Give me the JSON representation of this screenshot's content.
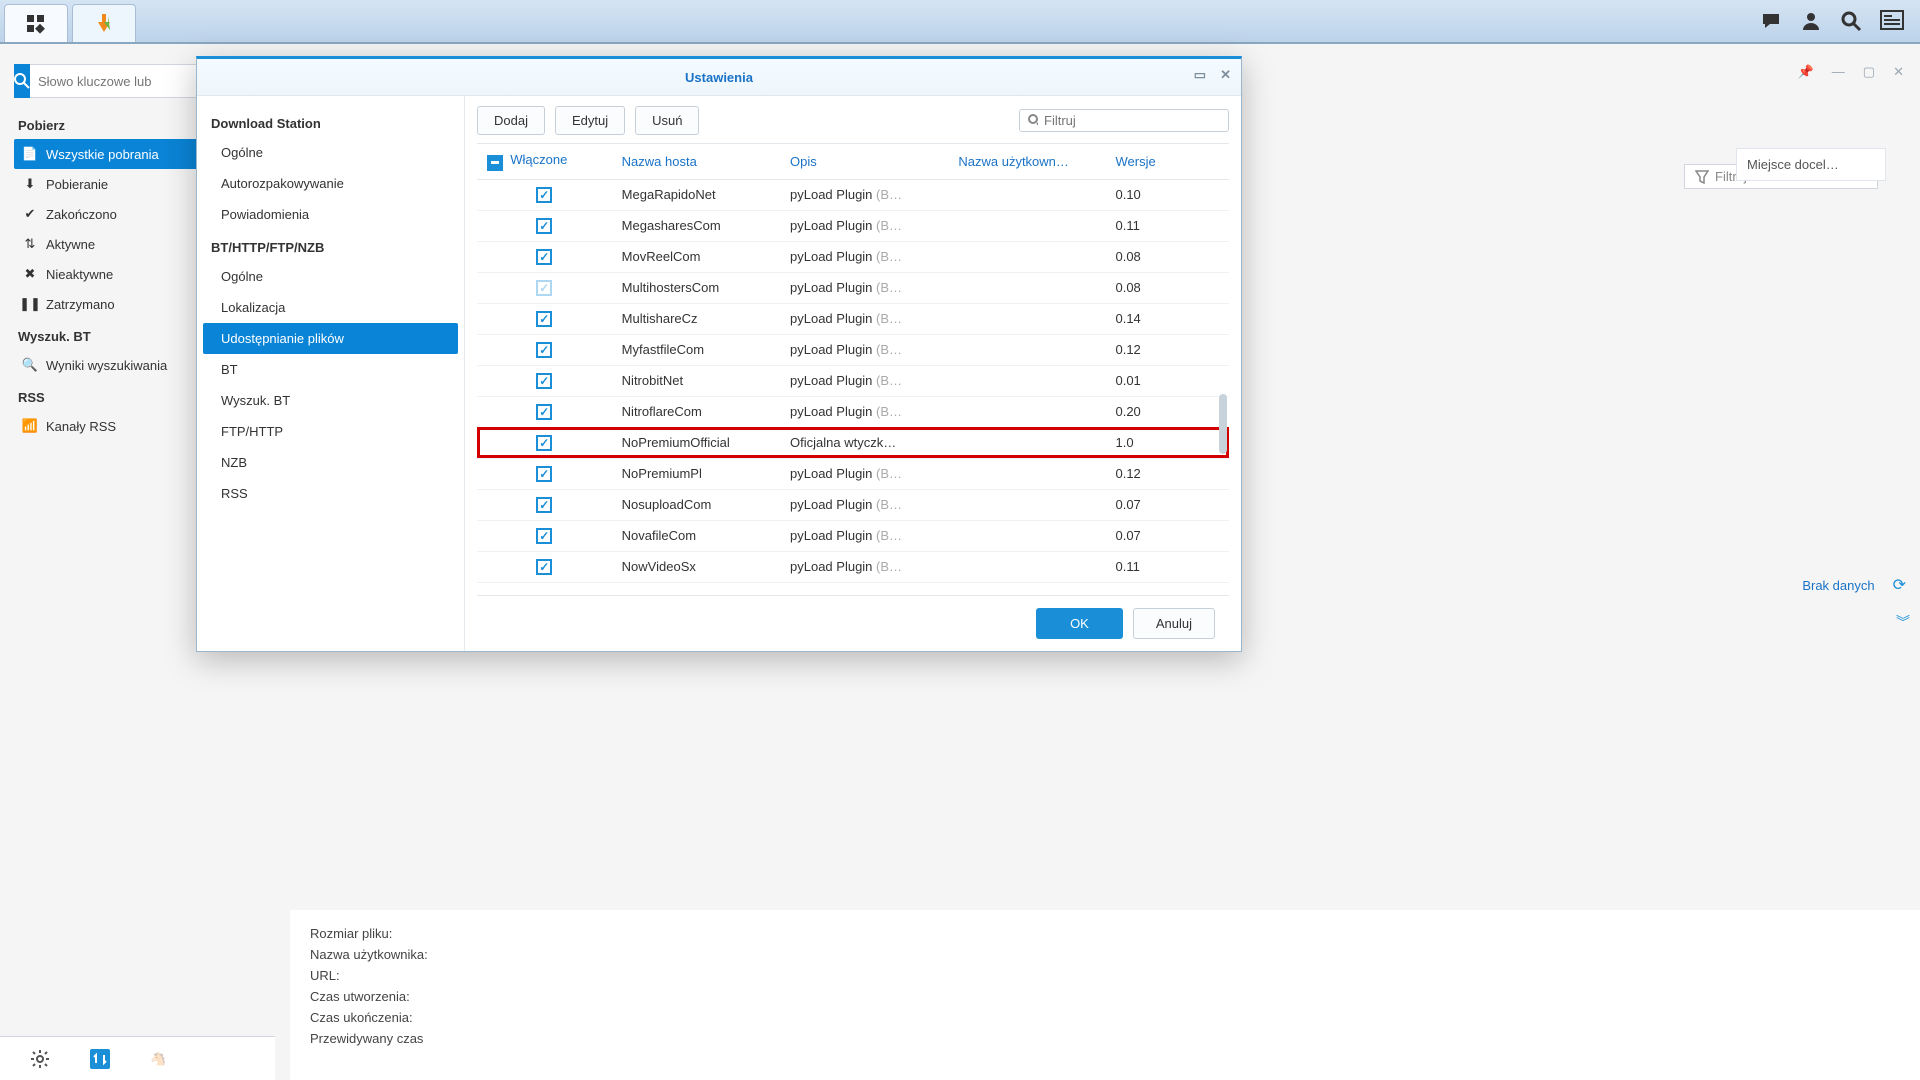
{
  "topbar": {
    "tooltip_chat": "chat",
    "tooltip_user": "user",
    "tooltip_search": "search",
    "tooltip_panel": "panel"
  },
  "app": {
    "search_placeholder": "Słowo kluczowe lub",
    "filter_placeholder": "Filtruj",
    "nav": {
      "downloads_hdr": "Pobierz",
      "all": "Wszystkie pobrania",
      "downloading": "Pobieranie",
      "finished": "Zakończono",
      "active": "Aktywne",
      "inactive": "Nieaktywne",
      "stopped": "Zatrzymano",
      "bt_hdr": "Wyszuk. BT",
      "bt_results": "Wyniki wyszukiwania",
      "rss_hdr": "RSS",
      "rss_channels": "Kanały RSS"
    },
    "dest_col": "Miejsce docel…",
    "no_data": "Brak danych",
    "details": {
      "size": "Rozmiar pliku:",
      "user": "Nazwa użytkownika:",
      "url": "URL:",
      "created": "Czas utworzenia:",
      "finished": "Czas ukończenia:",
      "eta": "Przewidywany czas"
    }
  },
  "modal": {
    "title": "Ustawienia",
    "side": {
      "grp_ds": "Download Station",
      "general": "Ogólne",
      "autoextract": "Autorozpakowywanie",
      "notify": "Powiadomienia",
      "grp_bt": "BT/HTTP/FTP/NZB",
      "general2": "Ogólne",
      "location": "Lokalizacja",
      "filehost": "Udostępnianie plików",
      "bt": "BT",
      "btsearch": "Wyszuk. BT",
      "ftphttp": "FTP/HTTP",
      "nzb": "NZB",
      "rss": "RSS"
    },
    "toolbar": {
      "add": "Dodaj",
      "edit": "Edytuj",
      "delete": "Usuń",
      "filter": "Filtruj"
    },
    "cols": {
      "enabled": "Włączone",
      "host": "Nazwa hosta",
      "desc": "Opis",
      "user": "Nazwa użytkown…",
      "ver": "Wersje"
    },
    "desc_prefix": "pyLoad Plugin ",
    "desc_suffix": "(B…",
    "rows": [
      {
        "host": "MegaRapidoNet",
        "ver": "0.10",
        "pl": true
      },
      {
        "host": "MegasharesCom",
        "ver": "0.11",
        "pl": true
      },
      {
        "host": "MovReelCom",
        "ver": "0.08",
        "pl": true
      },
      {
        "host": "MultihostersCom",
        "ver": "0.08",
        "pl": true,
        "faded": true
      },
      {
        "host": "MultishareCz",
        "ver": "0.14",
        "pl": true
      },
      {
        "host": "MyfastfileCom",
        "ver": "0.12",
        "pl": true
      },
      {
        "host": "NitrobitNet",
        "ver": "0.01",
        "pl": true
      },
      {
        "host": "NitroflareCom",
        "ver": "0.20",
        "pl": true
      },
      {
        "host": "NoPremiumOfficial",
        "ver": "1.0",
        "pl": false,
        "desc": "Oficjalna wtyczk…",
        "hl": true
      },
      {
        "host": "NoPremiumPl",
        "ver": "0.12",
        "pl": true
      },
      {
        "host": "NosuploadCom",
        "ver": "0.07",
        "pl": true
      },
      {
        "host": "NovafileCom",
        "ver": "0.07",
        "pl": true
      },
      {
        "host": "NowVideoSx",
        "ver": "0.11",
        "pl": true
      }
    ],
    "footer": {
      "ok": "OK",
      "cancel": "Anuluj"
    }
  }
}
